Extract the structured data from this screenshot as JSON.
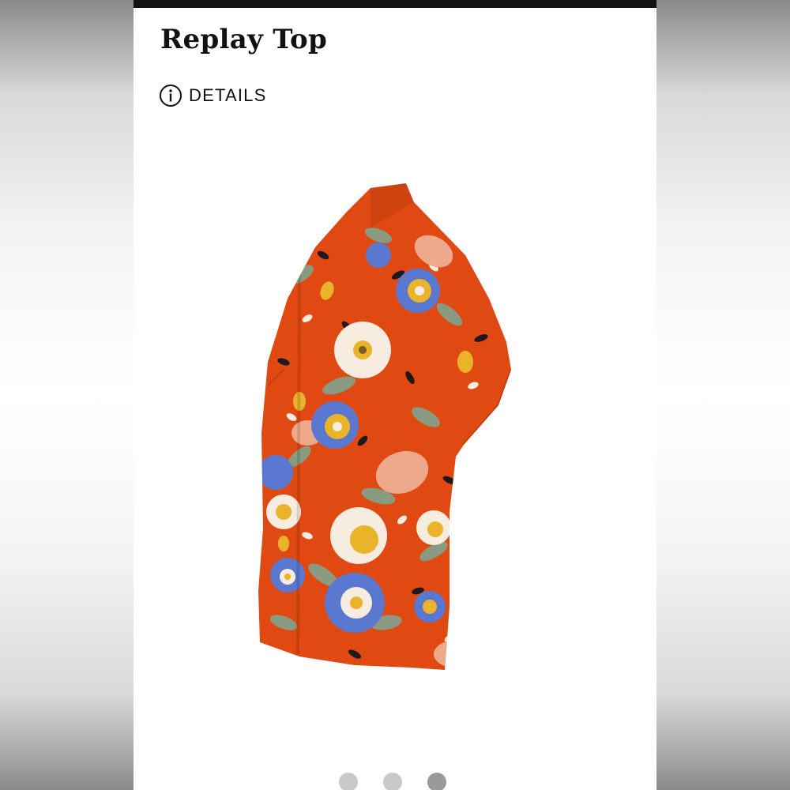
{
  "product": {
    "title": "Replay Top",
    "details_label": "DETAILS",
    "image_subject": "orange floral print short-sleeve button-up top"
  },
  "icons": {
    "info": "info-icon"
  },
  "carousel": {
    "total": 3,
    "active_index": 2
  },
  "colors": {
    "fabric_base": "#e04a12",
    "flower_blue": "#5a78d0",
    "flower_cream": "#f6ecdf",
    "flower_yellow": "#e9b32a",
    "flower_peach": "#eea98c",
    "leaf_sage": "#8a9a80",
    "leaf_dark": "#1e1a1c",
    "text": "#111111",
    "topbar": "#111111",
    "dot_inactive": "#c8c8c8",
    "dot_active": "#9a9a9a"
  }
}
